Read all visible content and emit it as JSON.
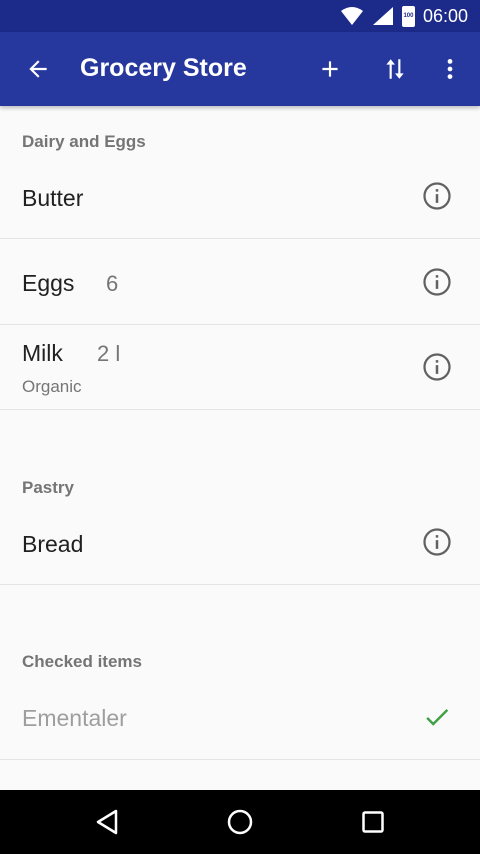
{
  "status_bar": {
    "time": "06:00",
    "battery_label": "100",
    "icons": [
      "wifi-icon",
      "signal-icon",
      "battery-icon"
    ]
  },
  "app_bar": {
    "title": "Grocery Store",
    "background": "#26389e",
    "actions": [
      "back-arrow-icon",
      "add-icon",
      "sort-icon",
      "more-vert-icon"
    ]
  },
  "sections": [
    {
      "header": "Dairy and Eggs",
      "items": [
        {
          "name": "Butter",
          "quantity": "",
          "note": ""
        },
        {
          "name": "Eggs",
          "quantity": "6",
          "note": ""
        },
        {
          "name": "Milk",
          "quantity": "2 l",
          "note": "Organic"
        }
      ]
    },
    {
      "header": "Pastry",
      "items": [
        {
          "name": "Bread",
          "quantity": "",
          "note": ""
        }
      ]
    },
    {
      "header": "Checked items",
      "items": [
        {
          "name": "Ementaler",
          "quantity": "",
          "note": "",
          "checked": true
        }
      ]
    }
  ],
  "colors": {
    "status_bar": "#1c2a8a",
    "check": "#43a047",
    "info_icon": "#616161"
  },
  "nav_bar": [
    "back-nav-icon",
    "home-nav-icon",
    "recents-nav-icon"
  ]
}
